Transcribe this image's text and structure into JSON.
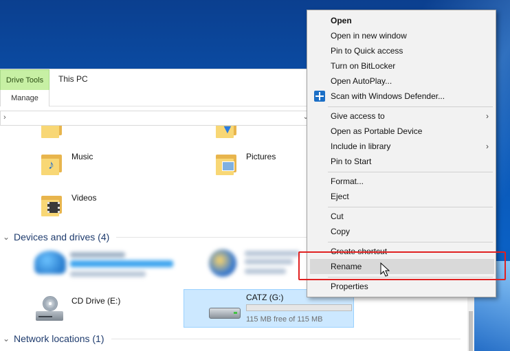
{
  "ribbon": {
    "context_tab": "Drive Tools",
    "manage_tab": "Manage",
    "window_title": "This PC"
  },
  "address": {
    "chevron": "›",
    "dropdown": "⌄"
  },
  "folders": [
    {
      "label": "Music",
      "icon": "music-folder-icon"
    },
    {
      "label": "Pictures",
      "icon": "pictures-folder-icon"
    },
    {
      "label": "Videos",
      "icon": "videos-folder-icon"
    }
  ],
  "sections": {
    "devices": "Devices and drives (4)",
    "network": "Network locations (1)"
  },
  "drives": {
    "cd": {
      "label": "CD Drive (E:)"
    },
    "catz": {
      "name": "CATZ (G:)",
      "free": "115 MB free of 115 MB",
      "used_fraction": 0.0
    }
  },
  "context_menu": {
    "items": [
      {
        "label": "Open",
        "bold": true
      },
      {
        "label": "Open in new window"
      },
      {
        "label": "Pin to Quick access"
      },
      {
        "label": "Turn on BitLocker"
      },
      {
        "label": "Open AutoPlay..."
      },
      {
        "label": "Scan with Windows Defender...",
        "icon": "windows-defender-icon"
      },
      {
        "label": "Give access to",
        "submenu": true
      },
      {
        "label": "Open as Portable Device"
      },
      {
        "label": "Include in library",
        "submenu": true
      },
      {
        "label": "Pin to Start"
      },
      {
        "label": "Format..."
      },
      {
        "label": "Eject"
      },
      {
        "label": "Cut"
      },
      {
        "label": "Copy"
      },
      {
        "label": "Create shortcut"
      },
      {
        "label": "Rename",
        "highlighted": true
      },
      {
        "label": "Properties"
      }
    ],
    "submenu_arrow": "›"
  },
  "colors": {
    "drive_tools_bg": "#c7f0a4",
    "selection_bg": "#cce8ff",
    "highlight_border": "#e02020",
    "desktop_blue": "#0b56b4"
  }
}
